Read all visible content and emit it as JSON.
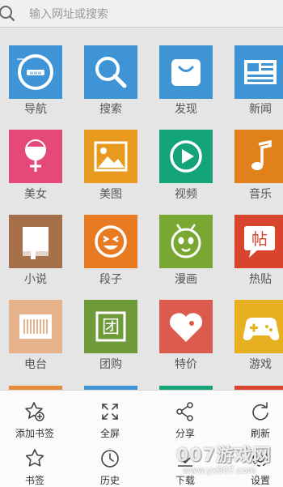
{
  "search": {
    "placeholder": "输入网址或搜索"
  },
  "tiles": [
    {
      "label": "导航",
      "icon": "navigation-icon",
      "color": "#3f94d6"
    },
    {
      "label": "搜索",
      "icon": "search-tile-icon",
      "color": "#3f94d6"
    },
    {
      "label": "发现",
      "icon": "shopping-bag-icon",
      "color": "#3f94d6"
    },
    {
      "label": "新闻",
      "icon": "newspaper-icon",
      "color": "#3f94d6"
    },
    {
      "label": "美女",
      "icon": "girl-icon",
      "color": "#e5497a"
    },
    {
      "label": "美图",
      "icon": "picture-icon",
      "color": "#e89a1e"
    },
    {
      "label": "视频",
      "icon": "play-icon",
      "color": "#14a47a"
    },
    {
      "label": "音乐",
      "icon": "music-note-icon",
      "color": "#e0811b"
    },
    {
      "label": "小说",
      "icon": "book-icon",
      "color": "#a56f4a"
    },
    {
      "label": "段子",
      "icon": "laugh-face-icon",
      "color": "#e87a22"
    },
    {
      "label": "漫画",
      "icon": "cartoon-bug-icon",
      "color": "#78a832"
    },
    {
      "label": "热贴",
      "icon": "post-bubble-icon",
      "color": "#d9442c"
    },
    {
      "label": "电台",
      "icon": "radio-icon",
      "color": "#e6b38c"
    },
    {
      "label": "团购",
      "icon": "group-buy-icon",
      "color": "#6f9a3a"
    },
    {
      "label": "特价",
      "icon": "price-tag-heart-icon",
      "color": "#dc5b4f"
    },
    {
      "label": "游戏",
      "icon": "gamepad-icon",
      "color": "#e6b020"
    }
  ],
  "partial_row_colors": [
    "#e88a3a",
    "#3f94d6",
    "#14a47a",
    "#d9442c"
  ],
  "menu": {
    "row1": [
      {
        "label": "添加书签",
        "icon": "add-bookmark-icon"
      },
      {
        "label": "全屏",
        "icon": "fullscreen-icon"
      },
      {
        "label": "分享",
        "icon": "share-icon"
      },
      {
        "label": "刷新",
        "icon": "refresh-icon"
      }
    ],
    "row2": [
      {
        "label": "书签",
        "icon": "bookmark-star-icon"
      },
      {
        "label": "历史",
        "icon": "history-clock-icon"
      },
      {
        "label": "下载",
        "icon": "download-icon"
      },
      {
        "label": "设置",
        "icon": "settings-icon"
      }
    ]
  },
  "watermark": {
    "title": "007游戏网",
    "url": "www.yx007.com"
  }
}
